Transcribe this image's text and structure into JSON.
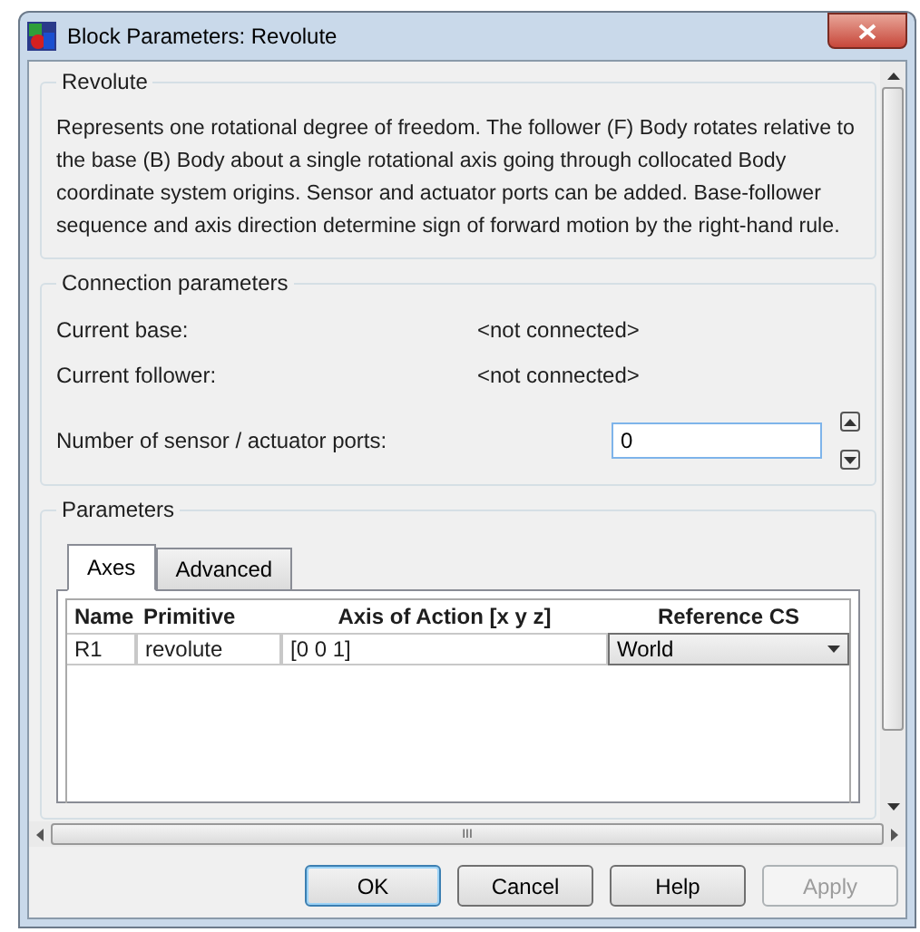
{
  "window": {
    "title": "Block Parameters: Revolute"
  },
  "description_group": {
    "title": "Revolute",
    "text": "Represents one rotational degree of freedom. The follower (F) Body rotates relative to the base (B) Body about a single rotational axis going through collocated Body coordinate system origins. Sensor and actuator ports can be added. Base-follower sequence and axis direction determine sign of forward motion by the right-hand rule."
  },
  "connection_group": {
    "title": "Connection parameters",
    "rows": [
      {
        "label": "Current base:",
        "value": "<not connected>"
      },
      {
        "label": "Current follower:",
        "value": "<not connected>"
      }
    ],
    "ports": {
      "label": "Number of sensor / actuator ports:",
      "value": "0"
    }
  },
  "parameters_group": {
    "title": "Parameters",
    "tabs": [
      {
        "label": "Axes",
        "selected": true
      },
      {
        "label": "Advanced",
        "selected": false
      }
    ],
    "table": {
      "columns": [
        "Name",
        "Primitive",
        "Axis of Action [x y z]",
        "Reference CS"
      ],
      "rows": [
        {
          "name": "R1",
          "primitive": "revolute",
          "axis": "[0 0 1]",
          "reference": "World"
        }
      ]
    }
  },
  "horizontal_scrollbar": {
    "grip": "III"
  },
  "buttons": [
    {
      "label": "OK",
      "default": true,
      "disabled": false
    },
    {
      "label": "Cancel",
      "default": false,
      "disabled": false
    },
    {
      "label": "Help",
      "default": false,
      "disabled": false
    },
    {
      "label": "Apply",
      "default": false,
      "disabled": true
    }
  ]
}
